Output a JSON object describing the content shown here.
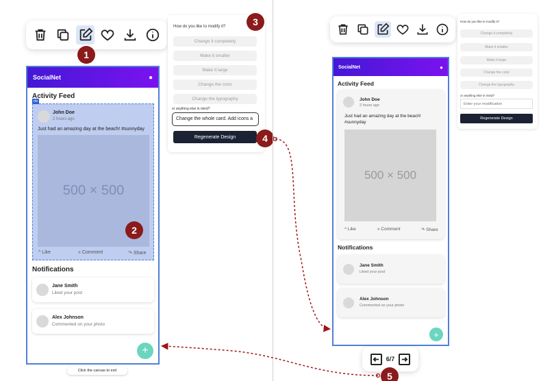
{
  "left": {
    "callouts": [
      "1",
      "2",
      "3",
      "4"
    ],
    "prompt": {
      "question": "How do you like to modify it?",
      "options": [
        "Change it completely",
        "Make it smaller",
        "Make it large",
        "Change the color",
        "Change the typography"
      ],
      "other_label": "or anything else in mind?",
      "input_value": "Change the whole card. Add icons a",
      "regenerate_label": "Regenerate Design"
    },
    "app": {
      "title": "SocialNet",
      "selection_tag": "div",
      "feed_title": "Activity Feed",
      "post": {
        "author": "John Doe",
        "time": "2 hours ago",
        "text": "Just had an amazing day at the beach! #sunnyday",
        "image_label": "500 × 500",
        "like": "Like",
        "comment": "Comment",
        "share": "Share"
      },
      "notifications_title": "Notifications",
      "notifications": [
        {
          "name": "Jane Smith",
          "text": "Liked your post"
        },
        {
          "name": "Alex Johnson",
          "text": "Commented on your photo"
        }
      ],
      "fab_symbol": "+"
    },
    "exit_hint": "Click the canvas to exit"
  },
  "right": {
    "prompt": {
      "question": "How do you like to modify it?",
      "options": [
        "Change it completely",
        "Make it smaller",
        "Make it large",
        "Change the color",
        "Change the typography"
      ],
      "other_label": "or anything else in mind?",
      "input_placeholder": "Enter your modification",
      "regenerate_label": "Regenerate Design"
    },
    "app": {
      "title": "SocialNet",
      "feed_title": "Activity Feed",
      "post": {
        "author": "John Doe",
        "time": "2 hours ago",
        "text": "Just had an amazing day at the beach! #sunnyday",
        "image_label": "500 × 500",
        "like": "Like",
        "comment": "Comment",
        "share": "Share"
      },
      "notifications_title": "Notifications",
      "notifications": [
        {
          "name": "Jane Smith",
          "text": "Liked your post"
        },
        {
          "name": "Alex Johnson",
          "text": "Commented on your photo"
        }
      ],
      "fab_symbol": "+"
    },
    "pager": {
      "text": "6/7"
    },
    "callout": "5"
  },
  "colors": {
    "accent": "#4f7fd6",
    "badge": "#8b1a1a",
    "appbar_start": "#4418d6",
    "appbar_end": "#7b12f0",
    "fab": "#6ad6bf",
    "arrow": "#a01515"
  }
}
